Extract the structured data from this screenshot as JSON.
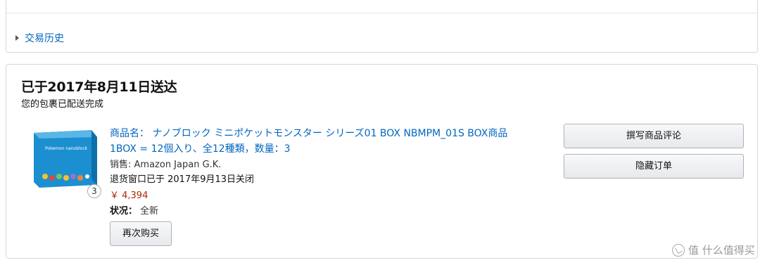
{
  "history": {
    "label": "交易历史"
  },
  "shipment": {
    "title": "已于2017年8月11日送达",
    "subtitle": "您的包裹已配送完成"
  },
  "item": {
    "title_line1": "商品名： ナノブロック ミニポケットモンスター シリーズ01 BOX NBMPM_01S BOX商品",
    "title_line2": "1BOX = 12個入り、全12種類，数量：3",
    "image_box_text": "Pokemon nanoblock",
    "quantity_badge": "3",
    "seller": "销售: Amazon Japan G.K.",
    "return_window": "退货窗口已于 2017年9月13日关闭",
    "price": "￥ 4,394",
    "condition_label": "状况：",
    "condition_value": "全新",
    "rebuy_label": "再次购买"
  },
  "actions": {
    "review_label": "撰写商品评论",
    "hide_label": "隐藏订单"
  },
  "watermark": "值 什么值得买",
  "colors": {
    "link": "#0066c0",
    "price": "#b12704",
    "border": "#d5d9d9",
    "box_blue": "#1c8fd1"
  }
}
